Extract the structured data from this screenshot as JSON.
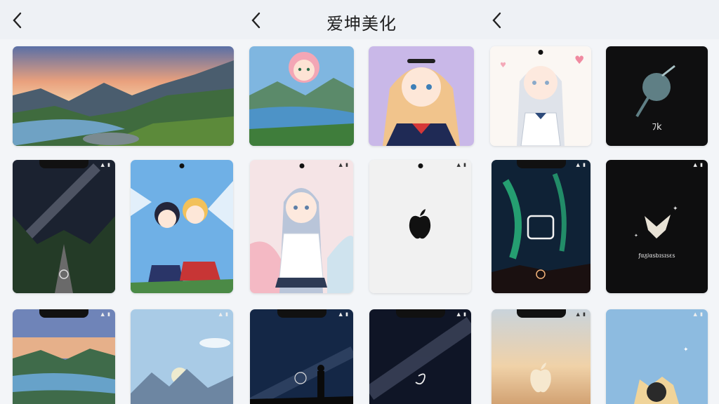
{
  "header": {
    "title": "爱坤美化",
    "back_count": 3
  },
  "tiles": [
    {
      "id": "lake-sunset",
      "type": "landscape"
    },
    {
      "id": "anime-pink-hair-lake",
      "type": "anime"
    },
    {
      "id": "anime-sailor-girl",
      "type": "anime"
    },
    {
      "id": "anime-silver-hair-hearts",
      "type": "anime"
    },
    {
      "id": "dark-key-icon",
      "caption": "ﾌk"
    },
    {
      "id": "milky-way-road",
      "type": "space"
    },
    {
      "id": "anime-fairy-duo",
      "type": "anime"
    },
    {
      "id": "anime-silver-hair-hoodie",
      "type": "anime"
    },
    {
      "id": "white-apple-logo",
      "type": "minimal"
    },
    {
      "id": "aurora-square",
      "type": "space"
    },
    {
      "id": "dark-star-fox",
      "caption": "ƒαᵹlαsbɪsɪsɛs"
    },
    {
      "id": "lake-valley-phone",
      "type": "landscape"
    },
    {
      "id": "mountain-sky-phone",
      "type": "landscape"
    },
    {
      "id": "night-silhouette-phone",
      "type": "space"
    },
    {
      "id": "galaxy-swirl-phone",
      "type": "space"
    },
    {
      "id": "sunset-apple-phone",
      "type": "minimal"
    },
    {
      "id": "blue-sky-cat-phone",
      "type": "anime"
    }
  ],
  "colors": {
    "background": "#f3f5f8",
    "header": "#eef1f5",
    "title": "#1f1f1f"
  }
}
